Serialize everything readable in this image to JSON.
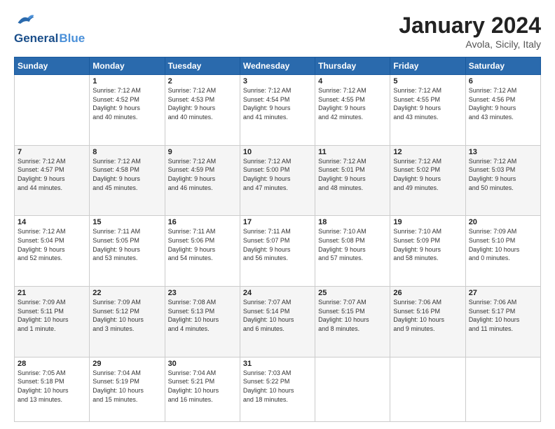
{
  "header": {
    "logo_line1": "General",
    "logo_line2": "Blue",
    "month": "January 2024",
    "location": "Avola, Sicily, Italy"
  },
  "days_of_week": [
    "Sunday",
    "Monday",
    "Tuesday",
    "Wednesday",
    "Thursday",
    "Friday",
    "Saturday"
  ],
  "weeks": [
    [
      {
        "day": "",
        "info": ""
      },
      {
        "day": "1",
        "info": "Sunrise: 7:12 AM\nSunset: 4:52 PM\nDaylight: 9 hours\nand 40 minutes."
      },
      {
        "day": "2",
        "info": "Sunrise: 7:12 AM\nSunset: 4:53 PM\nDaylight: 9 hours\nand 40 minutes."
      },
      {
        "day": "3",
        "info": "Sunrise: 7:12 AM\nSunset: 4:54 PM\nDaylight: 9 hours\nand 41 minutes."
      },
      {
        "day": "4",
        "info": "Sunrise: 7:12 AM\nSunset: 4:55 PM\nDaylight: 9 hours\nand 42 minutes."
      },
      {
        "day": "5",
        "info": "Sunrise: 7:12 AM\nSunset: 4:55 PM\nDaylight: 9 hours\nand 43 minutes."
      },
      {
        "day": "6",
        "info": "Sunrise: 7:12 AM\nSunset: 4:56 PM\nDaylight: 9 hours\nand 43 minutes."
      }
    ],
    [
      {
        "day": "7",
        "info": "Sunrise: 7:12 AM\nSunset: 4:57 PM\nDaylight: 9 hours\nand 44 minutes."
      },
      {
        "day": "8",
        "info": "Sunrise: 7:12 AM\nSunset: 4:58 PM\nDaylight: 9 hours\nand 45 minutes."
      },
      {
        "day": "9",
        "info": "Sunrise: 7:12 AM\nSunset: 4:59 PM\nDaylight: 9 hours\nand 46 minutes."
      },
      {
        "day": "10",
        "info": "Sunrise: 7:12 AM\nSunset: 5:00 PM\nDaylight: 9 hours\nand 47 minutes."
      },
      {
        "day": "11",
        "info": "Sunrise: 7:12 AM\nSunset: 5:01 PM\nDaylight: 9 hours\nand 48 minutes."
      },
      {
        "day": "12",
        "info": "Sunrise: 7:12 AM\nSunset: 5:02 PM\nDaylight: 9 hours\nand 49 minutes."
      },
      {
        "day": "13",
        "info": "Sunrise: 7:12 AM\nSunset: 5:03 PM\nDaylight: 9 hours\nand 50 minutes."
      }
    ],
    [
      {
        "day": "14",
        "info": "Sunrise: 7:12 AM\nSunset: 5:04 PM\nDaylight: 9 hours\nand 52 minutes."
      },
      {
        "day": "15",
        "info": "Sunrise: 7:11 AM\nSunset: 5:05 PM\nDaylight: 9 hours\nand 53 minutes."
      },
      {
        "day": "16",
        "info": "Sunrise: 7:11 AM\nSunset: 5:06 PM\nDaylight: 9 hours\nand 54 minutes."
      },
      {
        "day": "17",
        "info": "Sunrise: 7:11 AM\nSunset: 5:07 PM\nDaylight: 9 hours\nand 56 minutes."
      },
      {
        "day": "18",
        "info": "Sunrise: 7:10 AM\nSunset: 5:08 PM\nDaylight: 9 hours\nand 57 minutes."
      },
      {
        "day": "19",
        "info": "Sunrise: 7:10 AM\nSunset: 5:09 PM\nDaylight: 9 hours\nand 58 minutes."
      },
      {
        "day": "20",
        "info": "Sunrise: 7:09 AM\nSunset: 5:10 PM\nDaylight: 10 hours\nand 0 minutes."
      }
    ],
    [
      {
        "day": "21",
        "info": "Sunrise: 7:09 AM\nSunset: 5:11 PM\nDaylight: 10 hours\nand 1 minute."
      },
      {
        "day": "22",
        "info": "Sunrise: 7:09 AM\nSunset: 5:12 PM\nDaylight: 10 hours\nand 3 minutes."
      },
      {
        "day": "23",
        "info": "Sunrise: 7:08 AM\nSunset: 5:13 PM\nDaylight: 10 hours\nand 4 minutes."
      },
      {
        "day": "24",
        "info": "Sunrise: 7:07 AM\nSunset: 5:14 PM\nDaylight: 10 hours\nand 6 minutes."
      },
      {
        "day": "25",
        "info": "Sunrise: 7:07 AM\nSunset: 5:15 PM\nDaylight: 10 hours\nand 8 minutes."
      },
      {
        "day": "26",
        "info": "Sunrise: 7:06 AM\nSunset: 5:16 PM\nDaylight: 10 hours\nand 9 minutes."
      },
      {
        "day": "27",
        "info": "Sunrise: 7:06 AM\nSunset: 5:17 PM\nDaylight: 10 hours\nand 11 minutes."
      }
    ],
    [
      {
        "day": "28",
        "info": "Sunrise: 7:05 AM\nSunset: 5:18 PM\nDaylight: 10 hours\nand 13 minutes."
      },
      {
        "day": "29",
        "info": "Sunrise: 7:04 AM\nSunset: 5:19 PM\nDaylight: 10 hours\nand 15 minutes."
      },
      {
        "day": "30",
        "info": "Sunrise: 7:04 AM\nSunset: 5:21 PM\nDaylight: 10 hours\nand 16 minutes."
      },
      {
        "day": "31",
        "info": "Sunrise: 7:03 AM\nSunset: 5:22 PM\nDaylight: 10 hours\nand 18 minutes."
      },
      {
        "day": "",
        "info": ""
      },
      {
        "day": "",
        "info": ""
      },
      {
        "day": "",
        "info": ""
      }
    ]
  ]
}
